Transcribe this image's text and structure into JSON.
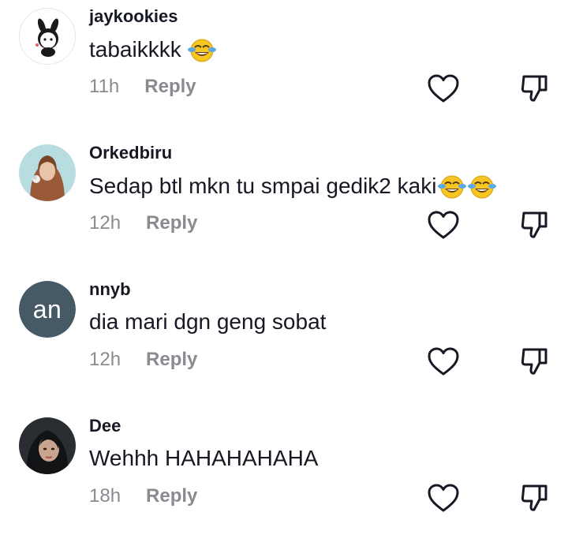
{
  "comments": [
    {
      "username": "jaykookies",
      "text": "tabaikkkk",
      "emoji_count": 1,
      "time": "11h",
      "reply_label": "Reply",
      "avatar": "cartoon-avatar"
    },
    {
      "username": "Orkedbiru",
      "text": "Sedap btl mkn tu smpai gedik2 kaki",
      "emoji_count": 2,
      "time": "12h",
      "reply_label": "Reply",
      "avatar": "hijab-photo-avatar"
    },
    {
      "username": "nnyb",
      "text": "dia mari dgn geng sobat",
      "emoji_count": 0,
      "time": "12h",
      "reply_label": "Reply",
      "avatar_initials": "an"
    },
    {
      "username": "Dee",
      "text": "Wehhh HAHAHAHAHA",
      "emoji_count": 0,
      "time": "18h",
      "reply_label": "Reply",
      "avatar": "photo-avatar"
    }
  ],
  "icons": {
    "like": "heart-outline-icon",
    "dislike": "thumbs-down-outline-icon",
    "emoji": "face-with-tears-of-joy-emoji"
  },
  "colors": {
    "text": "#161823",
    "secondary": "#8a8b91",
    "initials_avatar": "#455a64"
  }
}
